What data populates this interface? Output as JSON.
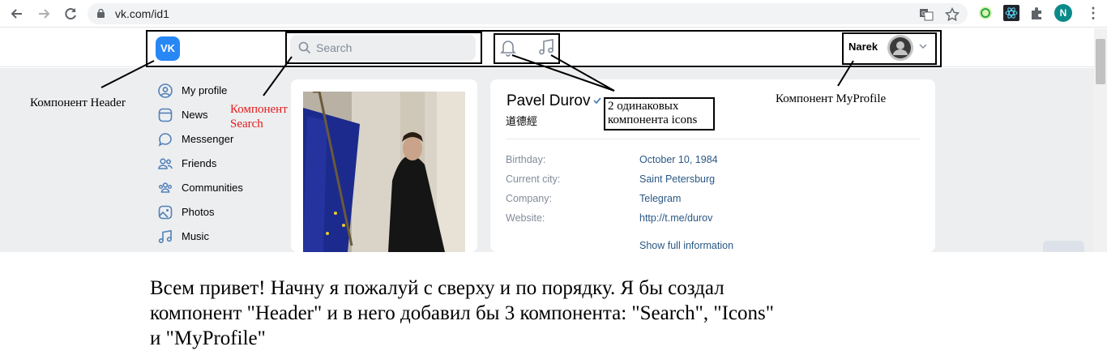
{
  "browser": {
    "url": "vk.com/id1",
    "icons": [
      "back-arrow-icon",
      "forward-arrow-icon",
      "reload-icon",
      "lock-icon",
      "translate-icon",
      "star-icon",
      "extension-icon",
      "react-devtools-icon",
      "puzzle-icon",
      "kebab-menu-icon"
    ],
    "profile_initial": "N",
    "profile_color": "#0b8a8a"
  },
  "header": {
    "logo_text": "VK",
    "brand_color": "#2787f5",
    "search_placeholder": "Search",
    "profile_name": "Narek"
  },
  "sidebar": {
    "items": [
      {
        "label": "My profile",
        "icon": "user-circle-icon"
      },
      {
        "label": "News",
        "icon": "news-icon"
      },
      {
        "label": "Messenger",
        "icon": "message-icon"
      },
      {
        "label": "Friends",
        "icon": "friends-icon"
      },
      {
        "label": "Communities",
        "icon": "communities-icon"
      },
      {
        "label": "Photos",
        "icon": "photo-icon"
      },
      {
        "label": "Music",
        "icon": "music-icon"
      }
    ]
  },
  "profile": {
    "name": "Pavel Durov",
    "status": "道德經",
    "fields": [
      {
        "label": "Birthday:",
        "value": "October 10, 1984"
      },
      {
        "label": "Current city:",
        "value": "Saint Petersburg"
      },
      {
        "label": "Company:",
        "value": "Telegram"
      },
      {
        "label": "Website:",
        "value": "http://t.me/durov"
      }
    ],
    "show_more": "Show full information"
  },
  "annotations": {
    "header_note": "Компонент Header",
    "search_note_line1": "Компонент",
    "search_note_line2": "Search",
    "icons_note_line1": "2 одинаковых",
    "icons_note_line2": "компонента icons",
    "myprofile_note": "Компонент MyProfile"
  },
  "caption": {
    "line1": "Всем привет! Начну я пожалуй с сверху и по порядку. Я бы создал",
    "line2": "компонент \"Header\" и в него добавил бы 3 компонента: \"Search\", \"Icons\"",
    "line3": "и \"MyProfile\""
  }
}
